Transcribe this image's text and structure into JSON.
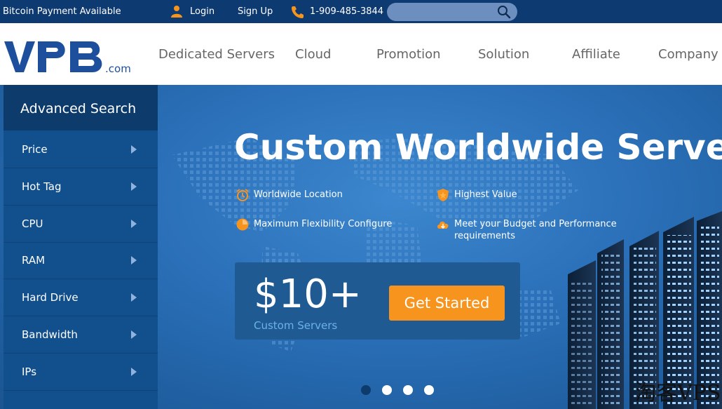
{
  "topbar": {
    "bitcoin_notice": "Bitcoin Payment Available",
    "login_label": "Login",
    "signup_label": "Sign Up",
    "phone": "1-909-485-3844",
    "search_placeholder": "",
    "icons": [
      "user-icon",
      "phone-icon",
      "search-icon"
    ],
    "background_color": "#0e3a72"
  },
  "logo": {
    "text": "VPB",
    "suffix": ".com",
    "color": "#1d4f9c"
  },
  "nav": {
    "items": [
      "Dedicated Servers",
      "Cloud",
      "Promotion",
      "Solution",
      "Affiliate",
      "Company"
    ]
  },
  "sidebar": {
    "title": "Advanced Search",
    "items": [
      "Price",
      "Hot Tag",
      "CPU",
      "RAM",
      "Hard Drive",
      "Bandwidth",
      "IPs"
    ]
  },
  "hero": {
    "headline": "Custom Worldwide Servers",
    "features": [
      {
        "icon": "clock-icon",
        "text": "Worldwide Location"
      },
      {
        "icon": "shield-icon",
        "text": "Highest Value"
      },
      {
        "icon": "pie-chart-icon",
        "text": "Maximum Flexibility Configure"
      },
      {
        "icon": "cloud-icon",
        "text": "Meet your Budget and Performance requirements"
      }
    ],
    "price": "$10+",
    "price_subtitle": "Custom Servers",
    "cta_label": "Get Started",
    "accent_color": "#f7941e",
    "slide_count": 4,
    "active_slide": 1
  },
  "watermark": "淘客VPS"
}
